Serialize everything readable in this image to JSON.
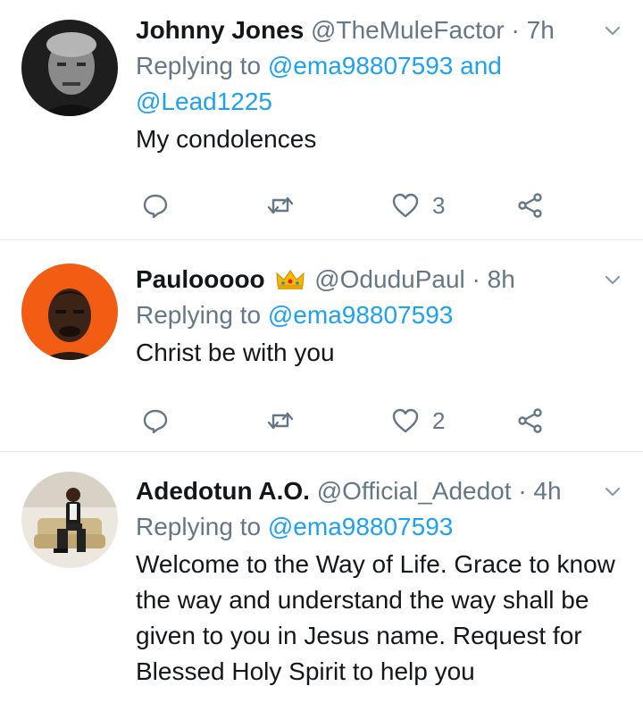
{
  "tweets": [
    {
      "name": "Johnny Jones",
      "handle": "@TheMuleFactor",
      "separator": "·",
      "time": "7h",
      "replying_prefix": "Replying to",
      "replying_mentions": "@ema98807593 and @Lead1225",
      "text": "My condolences",
      "like_count": "3",
      "avatar_colors": [
        "#2b2b2b",
        "#8a8a8a"
      ]
    },
    {
      "name": "Paulooooo",
      "badge_icon": "crown-emoji",
      "handle": "@OduduPaul",
      "separator": "·",
      "time": "8h",
      "replying_prefix": "Replying to",
      "replying_mentions": "@ema98807593",
      "text": "Christ be with you",
      "like_count": "2",
      "avatar_colors": [
        "#f25c13",
        "#3b2316"
      ]
    },
    {
      "name": "Adedotun A.O.",
      "handle": "@Official_Adedot",
      "separator": "·",
      "time": "4h",
      "replying_prefix": "Replying to",
      "replying_mentions": "@ema98807593",
      "text": "Welcome to the Way of Life. Grace to know the way and understand the way shall be given to you in Jesus name. Request for Blessed Holy Spirit to help you",
      "avatar_colors": [
        "#e8e2d8",
        "#c9b48a"
      ]
    }
  ],
  "colors": {
    "link": "#1da1f2",
    "secondary": "#657786",
    "primary_text": "#14171a",
    "divider": "#e1e8ed"
  },
  "icons": [
    "reply-icon",
    "retweet-icon",
    "like-icon",
    "share-icon",
    "caret-down-icon"
  ]
}
